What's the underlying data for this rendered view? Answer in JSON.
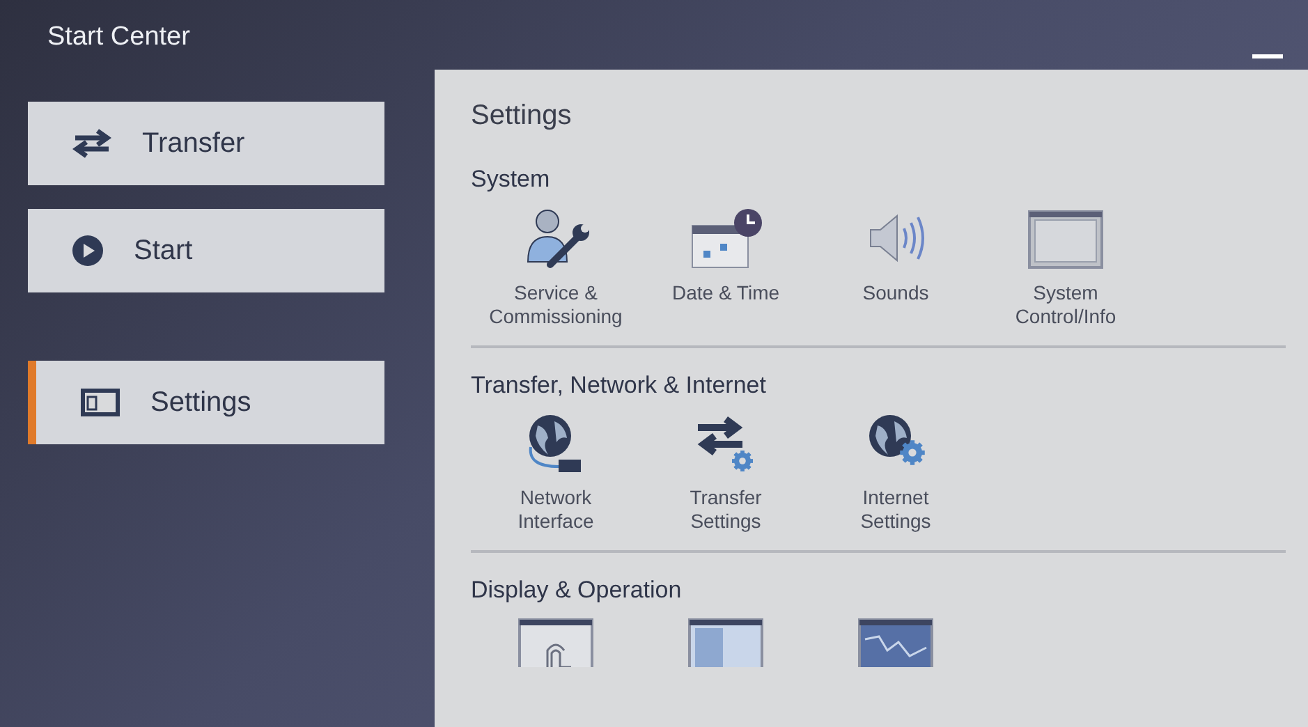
{
  "window": {
    "title": "Start Center"
  },
  "nav": [
    {
      "label": "Transfer",
      "kind": "transfer",
      "selected": false
    },
    {
      "label": "Start",
      "kind": "start",
      "selected": false
    },
    {
      "label": "Settings",
      "kind": "settings",
      "selected": true
    }
  ],
  "panel": {
    "title": "Settings",
    "sections": [
      {
        "title": "System",
        "items": [
          {
            "kind": "service",
            "label": "Service &\nCommissioning"
          },
          {
            "kind": "datetime",
            "label": "Date & Time"
          },
          {
            "kind": "sound",
            "label": "Sounds"
          },
          {
            "kind": "system",
            "label": "System\nControl/Info"
          }
        ]
      },
      {
        "title": "Transfer, Network & Internet",
        "items": [
          {
            "kind": "network",
            "label": "Network\nInterface"
          },
          {
            "kind": "transfer",
            "label": "Transfer\nSettings"
          },
          {
            "kind": "internet",
            "label": "Internet\nSettings"
          }
        ]
      },
      {
        "title": "Display & Operation",
        "items": [
          {
            "kind": "touch"
          },
          {
            "kind": "screen"
          },
          {
            "kind": "chart"
          }
        ]
      }
    ]
  }
}
